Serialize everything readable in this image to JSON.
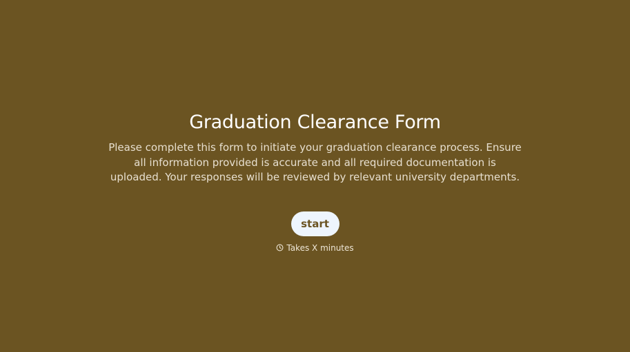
{
  "form": {
    "title": "Graduation Clearance Form",
    "description": "Please complete this form to initiate your graduation clearance process. Ensure all information provided is accurate and all required documentation is uploaded. Your responses will be reviewed by relevant university departments.",
    "start_label": "start",
    "duration_text": "Takes X minutes",
    "duration_icon": "clock-icon"
  },
  "colors": {
    "background": "#6b5422",
    "title": "#ffffff",
    "description": "#e7dfcf",
    "button_bg": "#eef5fd",
    "button_text": "#6b5422"
  }
}
